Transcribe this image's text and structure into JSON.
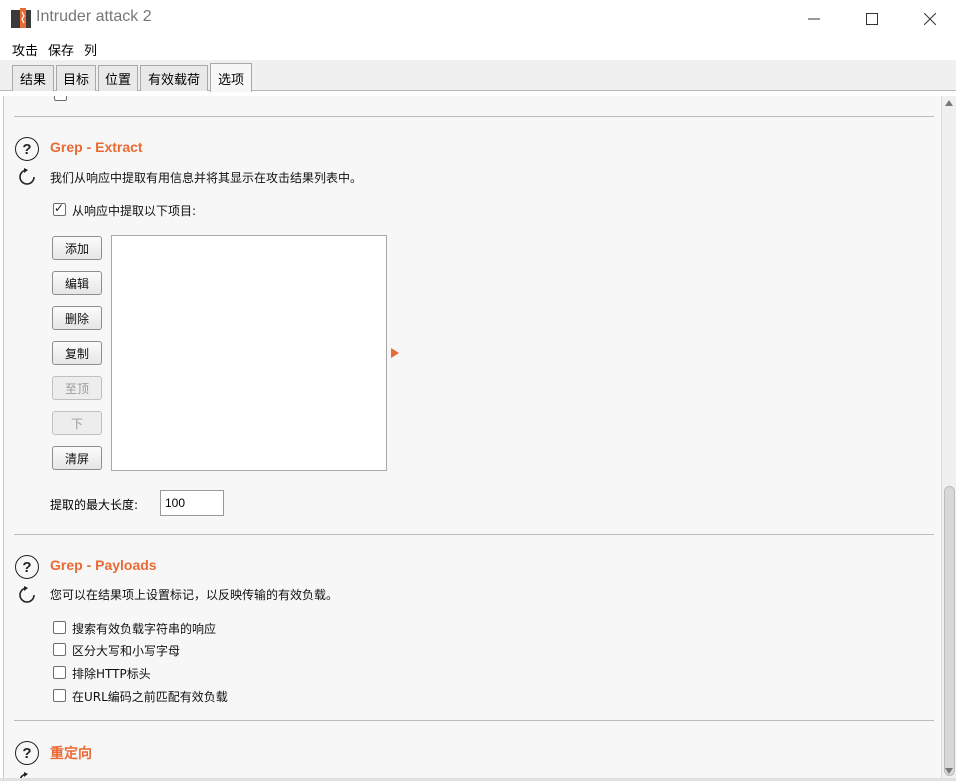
{
  "window": {
    "title": "Intruder attack 2",
    "minimize_glyph": "─",
    "maximize_glyph": "☐",
    "close_glyph": "✕"
  },
  "menu": [
    "攻击",
    "保存",
    "列"
  ],
  "tabs": [
    {
      "label": "结果"
    },
    {
      "label": "目标"
    },
    {
      "label": "位置"
    },
    {
      "label": "有效载荷"
    },
    {
      "label": "选项",
      "active": true
    }
  ],
  "grep_extract": {
    "title": "Grep - Extract",
    "description": "我们从响应中提取有用信息并将其显示在攻击结果列表中。",
    "checkbox_label": "从响应中提取以下项目:",
    "checkbox_checked": true,
    "buttons": {
      "add": "添加",
      "edit": "编辑",
      "remove": "删除",
      "duplicate": "复制",
      "up": "至顶",
      "down": "下",
      "clear": "清屏"
    },
    "max_length_label": "提取的最大长度:",
    "max_length_value": "100"
  },
  "grep_payloads": {
    "title": "Grep - Payloads",
    "description": "您可以在结果项上设置标记，以反映传输的有效负载。",
    "options": [
      {
        "label": "搜索有效负载字符串的响应",
        "checked": false
      },
      {
        "label": "区分大写和小写字母",
        "checked": false
      },
      {
        "label": "排除HTTP标头",
        "checked": false
      },
      {
        "label": "在URL编码之前匹配有效负载",
        "checked": false
      }
    ]
  },
  "redirections": {
    "title": "重定向"
  },
  "colors": {
    "accent": "#e96a35",
    "panel_bg": "#f7f7f7"
  },
  "icons": {
    "help": "help-circle-icon",
    "refresh": "refresh-icon",
    "app": "burp-logo-icon"
  }
}
